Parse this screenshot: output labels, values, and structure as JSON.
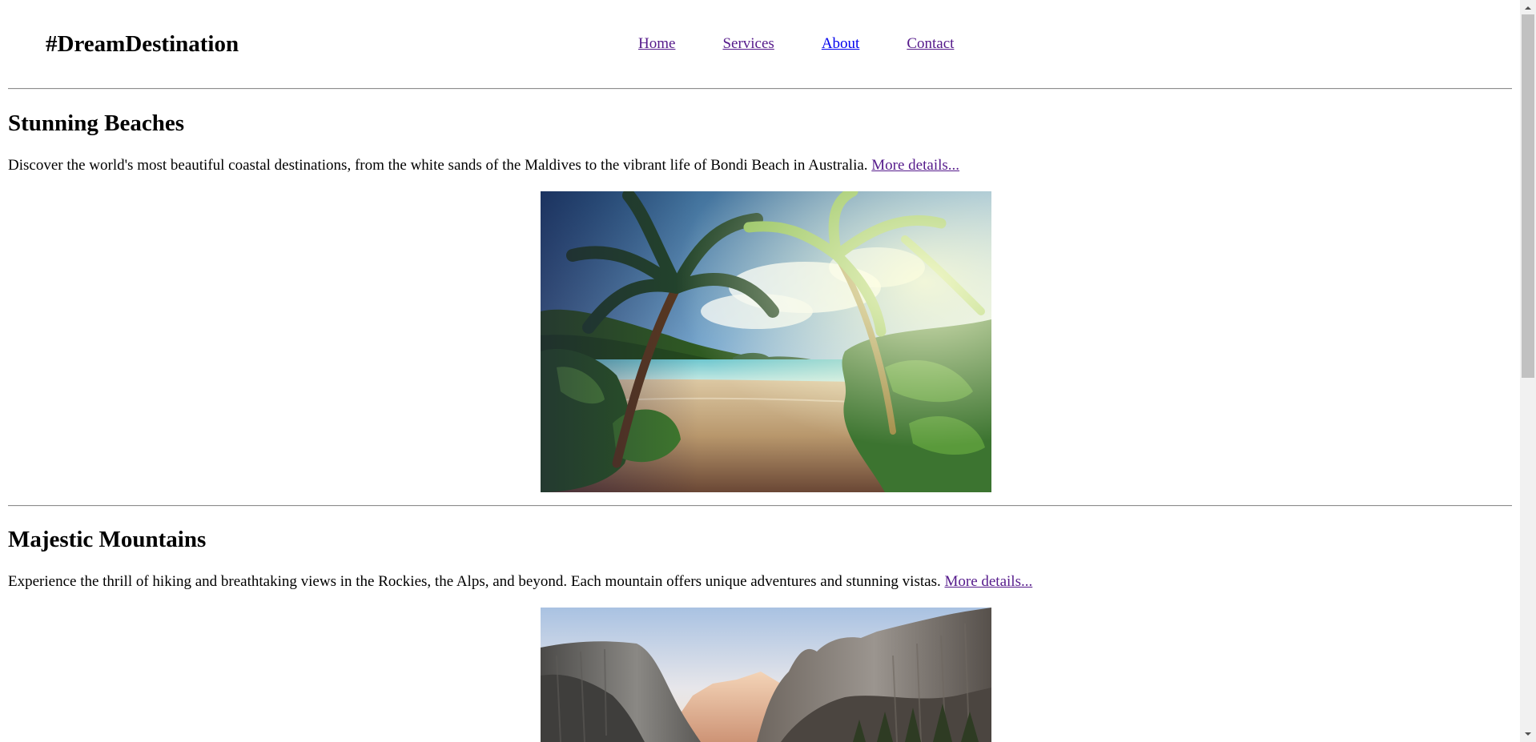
{
  "header": {
    "logo": "#DreamDestination",
    "nav": [
      {
        "label": "Home",
        "visited": true
      },
      {
        "label": "Services",
        "visited": true
      },
      {
        "label": "About",
        "visited": false
      },
      {
        "label": "Contact",
        "visited": true
      }
    ]
  },
  "sections": [
    {
      "title": "Stunning Beaches",
      "description": "Discover the world's most beautiful coastal destinations, from the white sands of the Maldives to the vibrant life of Bondi Beach in Australia.",
      "link": "More details...",
      "image": "tropical-beach-palms"
    },
    {
      "title": "Majestic Mountains",
      "description": "Experience the thrill of hiking and breathtaking views in the Rockies, the Alps, and beyond. Each mountain offers unique adventures and stunning vistas.",
      "link": "More details...",
      "image": "mountain-valley"
    }
  ],
  "colors": {
    "link": "#0000ee",
    "visited_link": "#551a8b",
    "rule": "#8e8e8e"
  }
}
